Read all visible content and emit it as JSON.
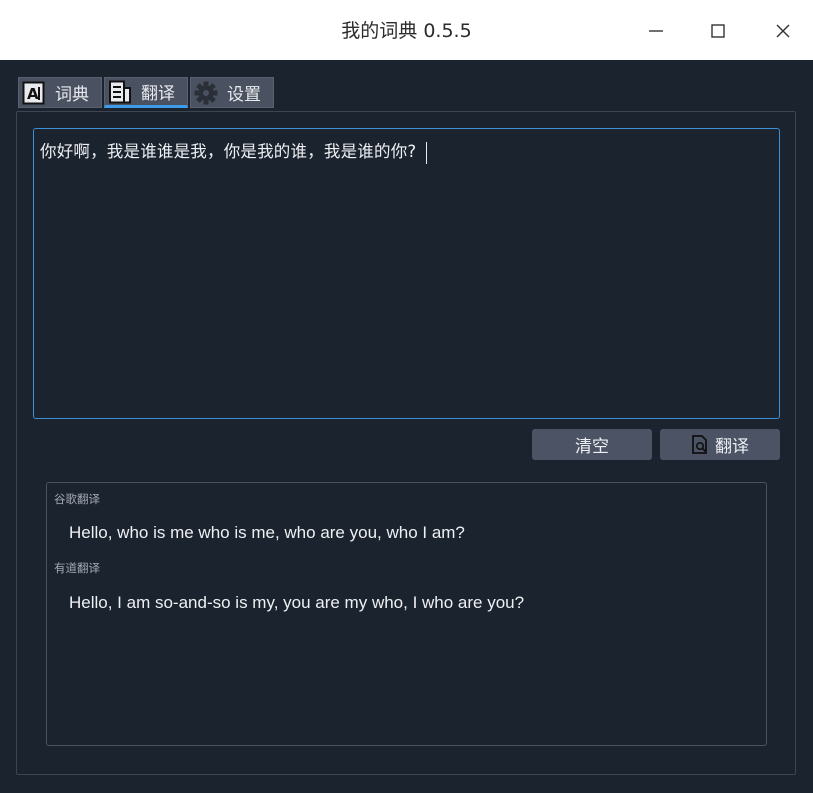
{
  "window": {
    "title": "我的词典 0.5.5",
    "controls": [
      "minimize-icon",
      "maximize-icon",
      "close-icon"
    ]
  },
  "tabs": [
    {
      "label": "词典",
      "icon": "dictionary-icon"
    },
    {
      "label": "翻译",
      "icon": "document-icon",
      "active": true
    },
    {
      "label": "设置",
      "icon": "gear-icon"
    }
  ],
  "input": {
    "value": "你好啊，我是谁谁是我，你是我的谁，我是谁的你?"
  },
  "buttons": {
    "clear_label": "清空",
    "translate_label": "翻译",
    "translate_icon": "search-document-icon"
  },
  "results": [
    {
      "source": "谷歌翻译",
      "text": "Hello, who is me who is me, who are you, who I am?"
    },
    {
      "source": "有道翻译",
      "text": "Hello, I am so-and-so is my, you are my who, I who are you?"
    }
  ],
  "colors": {
    "background": "#1b232e",
    "titlebar": "#ffffff",
    "accent": "#3d9be9",
    "button": "#4b5364",
    "tab": "#4a5160"
  }
}
